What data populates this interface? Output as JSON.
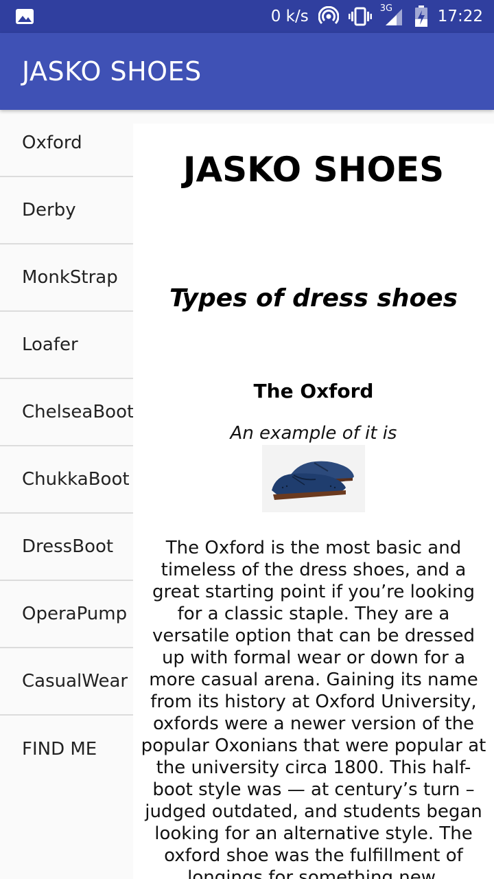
{
  "status_bar": {
    "left_icon": "image-notification-icon",
    "network_speed": "0 k/s",
    "icons": [
      "hotspot-icon",
      "vibrate-icon",
      "signal-3g-icon",
      "battery-charging-icon"
    ],
    "network_type": "3G",
    "time": "17:22"
  },
  "app_bar": {
    "title": "JASKO SHOES",
    "color": "#3f51b5"
  },
  "sidebar": {
    "items": [
      {
        "label": "Oxford"
      },
      {
        "label": "Derby"
      },
      {
        "label": "MonkStrap"
      },
      {
        "label": "Loafer"
      },
      {
        "label": "ChelseaBoot"
      },
      {
        "label": "ChukkaBoot"
      },
      {
        "label": "DressBoot"
      },
      {
        "label": "OperaPump"
      },
      {
        "label": "CasualWear"
      },
      {
        "label": "FIND ME"
      }
    ]
  },
  "content": {
    "heading": "JASKO SHOES",
    "subheading": "Types of dress shoes",
    "section_title": "The Oxford",
    "example_caption": "An example of it is",
    "image_icon": "oxford-shoe-image",
    "body": "The Oxford is the most basic and timeless of the dress shoes, and a great starting point if you’re looking for a classic staple. They are a versatile option that can be dressed up with formal wear or down for a more casual arena. Gaining its name from its history at Oxford University, oxfords were a newer version of the popular Oxonians that were popular at the university circa 1800. This half-boot style was — at century’s turn – judged outdated, and students began looking for an alternative style. The oxford shoe was the fulfillment of longings for something new."
  }
}
